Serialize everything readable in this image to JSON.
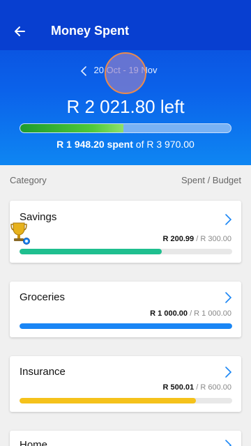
{
  "header": {
    "title": "Money Spent",
    "period": "20 Oct - 19 Nov",
    "left_amount": "R 2 021.80 left",
    "spent_amount": "R 1 948.20 spent",
    "of_budget": "of R 3 970.00",
    "overall_progress": 0.49,
    "colors": {
      "bar_top": "#083fd0",
      "header_bottom": "#0e86f2"
    }
  },
  "icons": {
    "back": "arrow-left-icon",
    "prev_period": "chevron-left-icon",
    "chevron": "chevron-right-icon",
    "trophy": "trophy-icon"
  },
  "columns": {
    "category": "Category",
    "spent_budget": "Spent / Budget"
  },
  "categories": [
    {
      "name": "Savings",
      "spent": "R 200.99",
      "budget": "/ R 300.00",
      "progress": 0.67,
      "color": "#1fbf8f",
      "badge": "trophy-icon"
    },
    {
      "name": "Groceries",
      "spent": "R 1 000.00",
      "budget": "/ R 1 000.00",
      "progress": 1.0,
      "color": "#1a86f5"
    },
    {
      "name": "Insurance",
      "spent": "R 500.01",
      "budget": "/ R 600.00",
      "progress": 0.83,
      "color": "#f5c21b"
    },
    {
      "name": "Home"
    }
  ]
}
